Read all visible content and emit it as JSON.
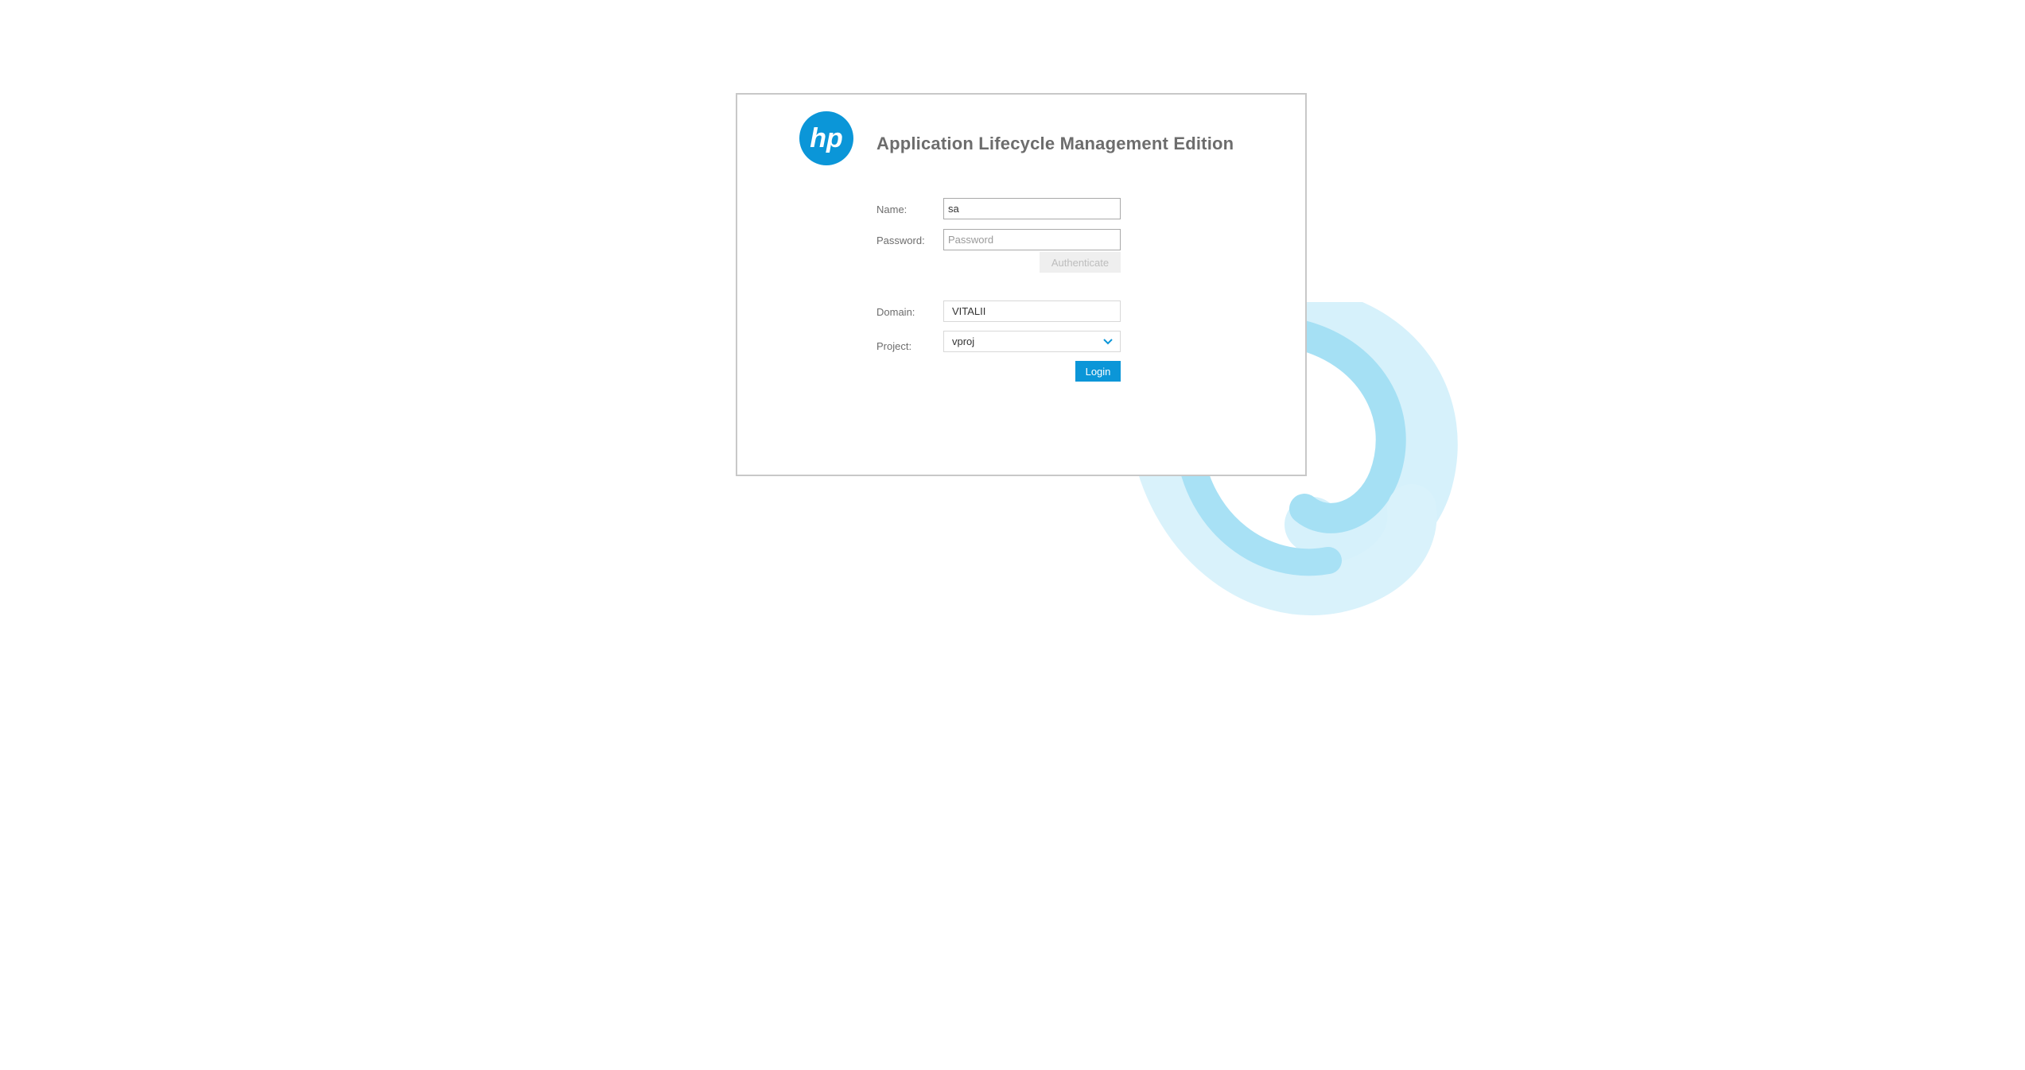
{
  "brand": {
    "logo_text": "hp",
    "app_title": "Application Lifecycle Management Edition",
    "accent_color": "#0b96d8",
    "swirl_color": "#9ddcf2"
  },
  "form": {
    "name_label": "Name:",
    "name_value": "sa",
    "password_label": "Password:",
    "password_placeholder": "Password",
    "authenticate_label": "Authenticate",
    "domain_label": "Domain:",
    "domain_value": "VITALII",
    "project_label": "Project:",
    "project_value": "vproj",
    "project_icon": "chevron-down-icon",
    "login_label": "Login"
  }
}
